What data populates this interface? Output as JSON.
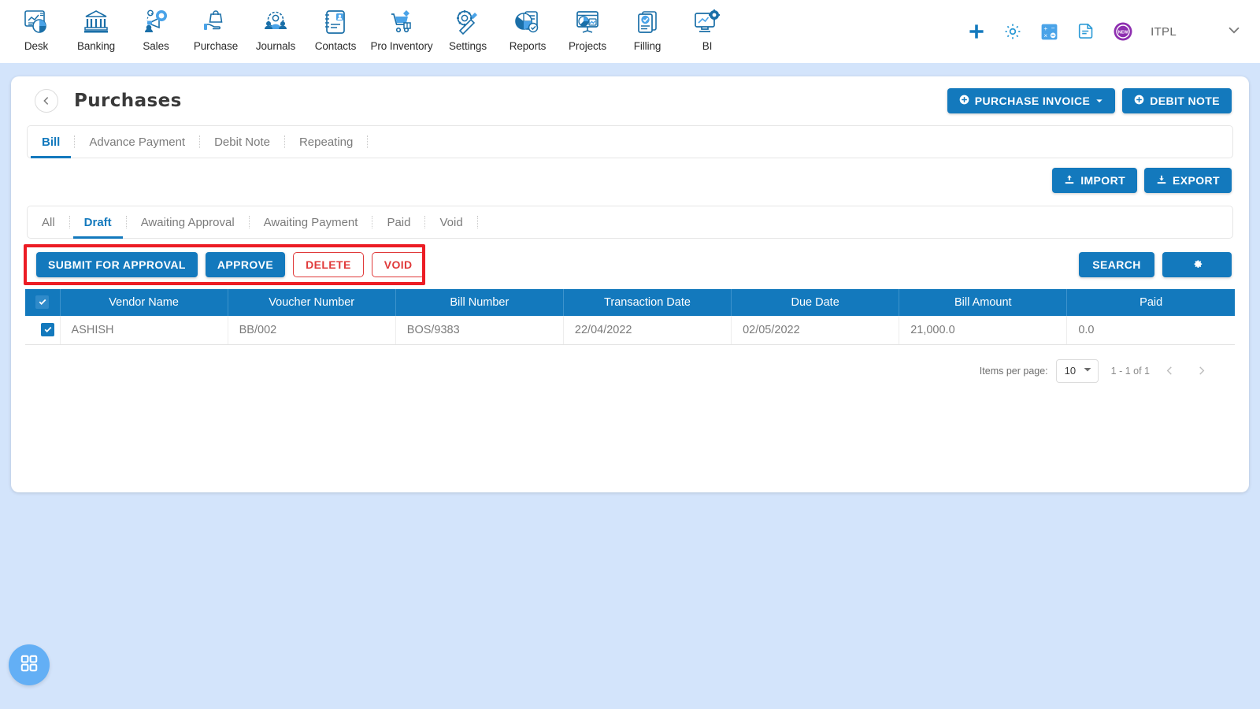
{
  "topnav": {
    "items": [
      {
        "label": "Desk",
        "icon": "dashboard-icon"
      },
      {
        "label": "Banking",
        "icon": "bank-icon"
      },
      {
        "label": "Sales",
        "icon": "megaphone-icon"
      },
      {
        "label": "Purchase",
        "icon": "hand-bag-icon"
      },
      {
        "label": "Journals",
        "icon": "people-gear-icon"
      },
      {
        "label": "Contacts",
        "icon": "address-book-icon"
      },
      {
        "label": "Pro Inventory",
        "icon": "cart-boxes-icon"
      },
      {
        "label": "Settings",
        "icon": "gear-wrench-icon"
      },
      {
        "label": "Reports",
        "icon": "pie-report-icon"
      },
      {
        "label": "Projects",
        "icon": "presentation-icon"
      },
      {
        "label": "Filling",
        "icon": "documents-check-icon"
      },
      {
        "label": "BI",
        "icon": "monitor-gear-icon"
      }
    ],
    "tools": [
      {
        "name": "add-icon"
      },
      {
        "name": "gear-icon"
      },
      {
        "name": "calculator-icon"
      },
      {
        "name": "notes-icon"
      },
      {
        "name": "new-badge-icon",
        "text": "NEW"
      }
    ],
    "org": "ITPL",
    "chevron": "chevron-down-icon"
  },
  "header": {
    "back": "back-icon",
    "title": "Purchases",
    "actions": [
      {
        "label": "PURCHASE INVOICE",
        "icon": "plus-circle-icon",
        "caret": true
      },
      {
        "label": "DEBIT NOTE",
        "icon": "plus-circle-icon",
        "caret": false
      }
    ]
  },
  "doc_tabs": {
    "items": [
      {
        "label": "Bill",
        "active": true
      },
      {
        "label": "Advance Payment",
        "active": false
      },
      {
        "label": "Debit Note",
        "active": false
      },
      {
        "label": "Repeating",
        "active": false
      }
    ]
  },
  "export_bar": {
    "import_label": "IMPORT",
    "import_icon": "upload-icon",
    "export_label": "EXPORT",
    "export_icon": "download-icon"
  },
  "status_tabs": {
    "items": [
      {
        "label": "All",
        "active": false
      },
      {
        "label": "Draft",
        "active": true
      },
      {
        "label": "Awaiting Approval",
        "active": false
      },
      {
        "label": "Awaiting Payment",
        "active": false
      },
      {
        "label": "Paid",
        "active": false
      },
      {
        "label": "Void",
        "active": false
      }
    ]
  },
  "actions": {
    "submit_label": "SUBMIT FOR APPROVAL",
    "approve_label": "APPROVE",
    "delete_label": "DELETE",
    "void_label": "VOID",
    "search_label": "SEARCH",
    "settings_icon": "gear-icon",
    "highlight_color": "#ec1c24"
  },
  "table": {
    "columns": [
      "Vendor Name",
      "Voucher Number",
      "Bill Number",
      "Transaction Date",
      "Due Date",
      "Bill Amount",
      "Paid"
    ],
    "select_all_checked": true,
    "rows": [
      {
        "checked": true,
        "vendor_name": "ASHISH",
        "voucher_number": "BB/002",
        "bill_number": "BOS/9383",
        "transaction_date": "22/04/2022",
        "due_date": "02/05/2022",
        "bill_amount": "21,000.0",
        "paid": "0.0"
      }
    ]
  },
  "pagination": {
    "items_per_page_label": "Items per page:",
    "items_per_page_value": "10",
    "range": "1 - 1 of 1",
    "prev_icon": "chevron-left-icon",
    "next_icon": "chevron-right-icon"
  },
  "fab": {
    "icon": "grid-apps-icon"
  },
  "theme": {
    "accent": "#1379bd",
    "page_bg": "#d3e4fb",
    "danger": "#e03a3a"
  }
}
